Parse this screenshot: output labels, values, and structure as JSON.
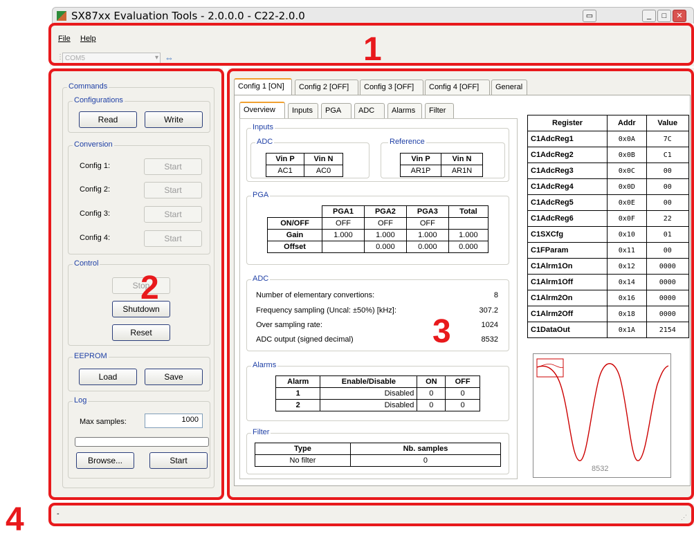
{
  "window": {
    "title": "SX87xx Evaluation Tools - 2.0.0.0 - C22-2.0.0"
  },
  "menu": {
    "file": "File",
    "help": "Help"
  },
  "toolbar": {
    "com_port": "COM5"
  },
  "annotations": {
    "n1": "1",
    "n2": "2",
    "n3": "3",
    "n4": "4"
  },
  "left": {
    "commands_label": "Commands",
    "configurations_label": "Configurations",
    "read_label": "Read",
    "write_label": "Write",
    "conversion_label": "Conversion",
    "configs": [
      {
        "label": "Config 1:",
        "button": "Start"
      },
      {
        "label": "Config 2:",
        "button": "Start"
      },
      {
        "label": "Config 3:",
        "button": "Start"
      },
      {
        "label": "Config 4:",
        "button": "Start"
      }
    ],
    "control_label": "Control",
    "stop_label": "Stop",
    "shutdown_label": "Shutdown",
    "reset_label": "Reset",
    "eeprom_label": "EEPROM",
    "load_label": "Load",
    "save_label": "Save",
    "log_label": "Log",
    "max_samples_label": "Max samples:",
    "max_samples_value": "1000",
    "log_progress": 0,
    "browse_label": "Browse...",
    "start_label": "Start"
  },
  "tabs": [
    "Config 1 [ON]",
    "Config 2 [OFF]",
    "Config 3 [OFF]",
    "Config 4 [OFF]",
    "General"
  ],
  "subtabs": [
    "Overview",
    "Inputs",
    "PGA",
    "ADC",
    "Alarms",
    "Filter"
  ],
  "inputs": {
    "label": "Inputs",
    "adc_label": "ADC",
    "reference_label": "Reference",
    "adc_headers": [
      "Vin P",
      "Vin N"
    ],
    "adc_values": [
      "AC1",
      "AC0"
    ],
    "ref_headers": [
      "Vin P",
      "Vin N"
    ],
    "ref_values": [
      "AR1P",
      "AR1N"
    ]
  },
  "pga": {
    "label": "PGA",
    "headers": [
      "PGA1",
      "PGA2",
      "PGA3",
      "Total"
    ],
    "rows": [
      {
        "name": "ON/OFF",
        "values": [
          "OFF",
          "OFF",
          "OFF",
          ""
        ]
      },
      {
        "name": "Gain",
        "values": [
          "1.000",
          "1.000",
          "1.000",
          "1.000"
        ]
      },
      {
        "name": "Offset",
        "values": [
          "",
          "0.000",
          "0.000",
          "0.000"
        ]
      }
    ]
  },
  "adc": {
    "label": "ADC",
    "rows": [
      {
        "label": "Number of elementary convertions:",
        "value": "8"
      },
      {
        "label": "Frequency sampling (Uncal: ±50%) [kHz]:",
        "value": "307.2"
      },
      {
        "label": "Over sampling rate:",
        "value": "1024"
      },
      {
        "label": "ADC output (signed decimal)",
        "value": "8532"
      }
    ]
  },
  "alarms": {
    "label": "Alarms",
    "headers": [
      "Alarm",
      "Enable/Disable",
      "ON",
      "OFF"
    ],
    "rows": [
      [
        "1",
        "Disabled",
        "0",
        "0"
      ],
      [
        "2",
        "Disabled",
        "0",
        "0"
      ]
    ]
  },
  "filter": {
    "label": "Filter",
    "headers": [
      "Type",
      "Nb. samples"
    ],
    "row": [
      "No filter",
      "0"
    ]
  },
  "registers": {
    "headers": [
      "Register",
      "Addr",
      "Value"
    ],
    "rows": [
      [
        "C1AdcReg1",
        "0x0A",
        "7C"
      ],
      [
        "C1AdcReg2",
        "0x0B",
        "C1"
      ],
      [
        "C1AdcReg3",
        "0x0C",
        "00"
      ],
      [
        "C1AdcReg4",
        "0x0D",
        "00"
      ],
      [
        "C1AdcReg5",
        "0x0E",
        "00"
      ],
      [
        "C1AdcReg6",
        "0x0F",
        "22"
      ],
      [
        "C1SXCfg",
        "0x10",
        "01"
      ],
      [
        "C1FParam",
        "0x11",
        "00"
      ],
      [
        "C1Alrm1On",
        "0x12",
        "0000"
      ],
      [
        "C1Alrm1Off",
        "0x14",
        "0000"
      ],
      [
        "C1Alrm2On",
        "0x16",
        "0000"
      ],
      [
        "C1Alrm2Off",
        "0x18",
        "0000"
      ],
      [
        "C1DataOut",
        "0x1A",
        "2154"
      ]
    ]
  },
  "plot": {
    "value_label": "8532",
    "color": "#cc0000"
  },
  "statusbar": {
    "text": "-"
  },
  "colors": {
    "annotation": "#e8191c",
    "group_label": "#1e3fa5"
  }
}
